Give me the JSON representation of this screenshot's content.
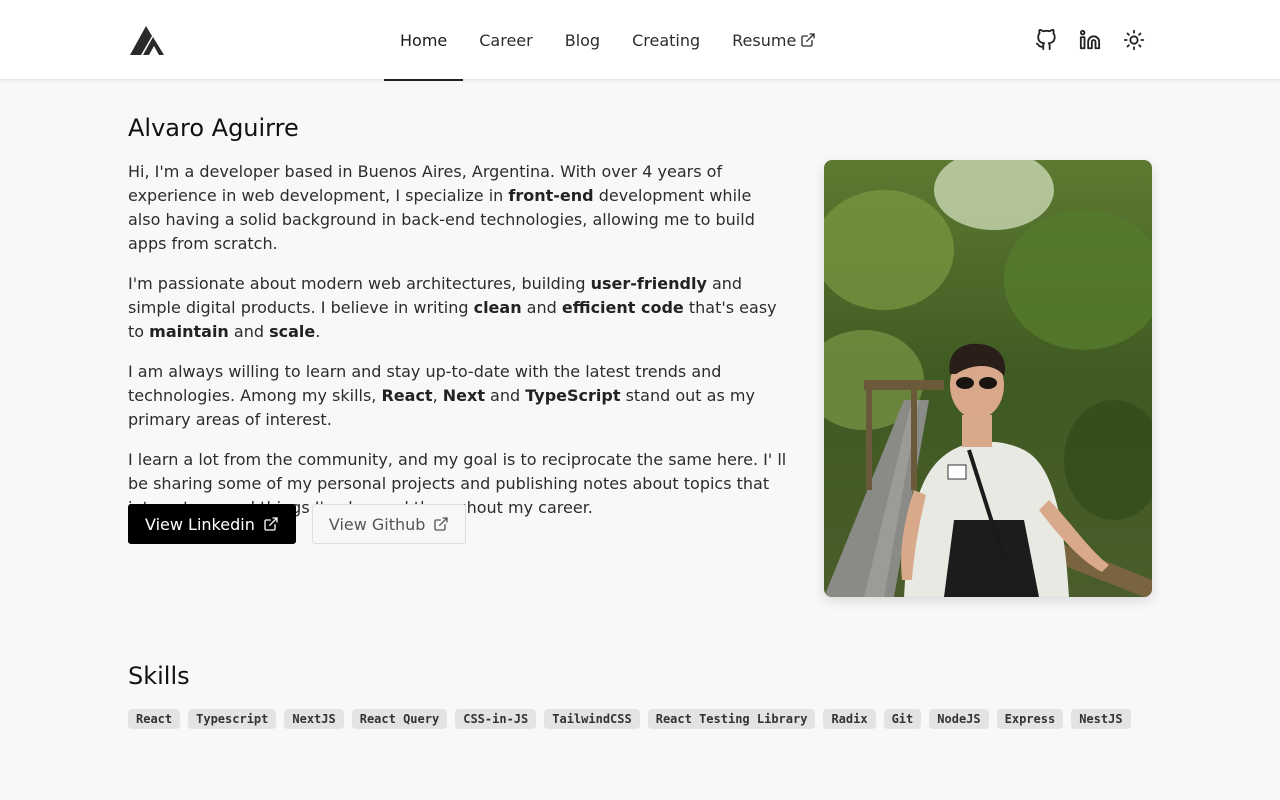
{
  "nav": {
    "logo": "logo-mark",
    "links": [
      {
        "label": "Home",
        "active": true
      },
      {
        "label": "Career",
        "active": false
      },
      {
        "label": "Blog",
        "active": false
      },
      {
        "label": "Creating",
        "active": false
      },
      {
        "label": "Resume",
        "active": false,
        "external": true
      }
    ],
    "icons": [
      "github-icon",
      "linkedin-icon",
      "sun-icon"
    ]
  },
  "profile": {
    "name": "Alvaro Aguirre",
    "bio": [
      [
        {
          "t": "Hi, I'm a developer based in Buenos Aires, Argentina. With over 4 years of experience in web development, I specialize in "
        },
        {
          "t": "front-end",
          "b": true
        },
        {
          "t": " development while also having a solid background in back-end technologies, allowing me to build apps from scratch."
        }
      ],
      [
        {
          "t": "I'm passionate about modern web architectures, building "
        },
        {
          "t": "user-friendly",
          "b": true
        },
        {
          "t": " and simple digital products. I believe in writing "
        },
        {
          "t": "clean",
          "b": true
        },
        {
          "t": " and "
        },
        {
          "t": "efficient code",
          "b": true
        },
        {
          "t": " that's easy to "
        },
        {
          "t": "maintain",
          "b": true
        },
        {
          "t": " and "
        },
        {
          "t": "scale",
          "b": true
        },
        {
          "t": "."
        }
      ],
      [
        {
          "t": "I am always willing to learn and stay up-to-date with the latest trends and technologies. Among my skills, "
        },
        {
          "t": "React",
          "b": true
        },
        {
          "t": ", "
        },
        {
          "t": "Next",
          "b": true
        },
        {
          "t": " and "
        },
        {
          "t": "TypeScript",
          "b": true
        },
        {
          "t": " stand out as my primary areas of interest."
        }
      ],
      [
        {
          "t": "I learn a lot from the community, and my goal is to reciprocate the same here. I' ll be sharing some of my personal projects and publishing notes about topics that interest me and things I've learned throughout my career."
        }
      ]
    ],
    "buttons": {
      "linkedin": "View Linkedin",
      "github": "View Github"
    }
  },
  "skills": {
    "title": "Skills",
    "items": [
      "React",
      "Typescript",
      "NextJS",
      "React Query",
      "CSS-in-JS",
      "TailwindCSS",
      "React Testing Library",
      "Radix",
      "Git",
      "NodeJS",
      "Express",
      "NestJS"
    ]
  },
  "colors": {
    "page_bg": "#f8f8f8",
    "nav_bg": "#ffffff",
    "primary_button": "#000000",
    "tag_bg": "#e3e3e3"
  }
}
